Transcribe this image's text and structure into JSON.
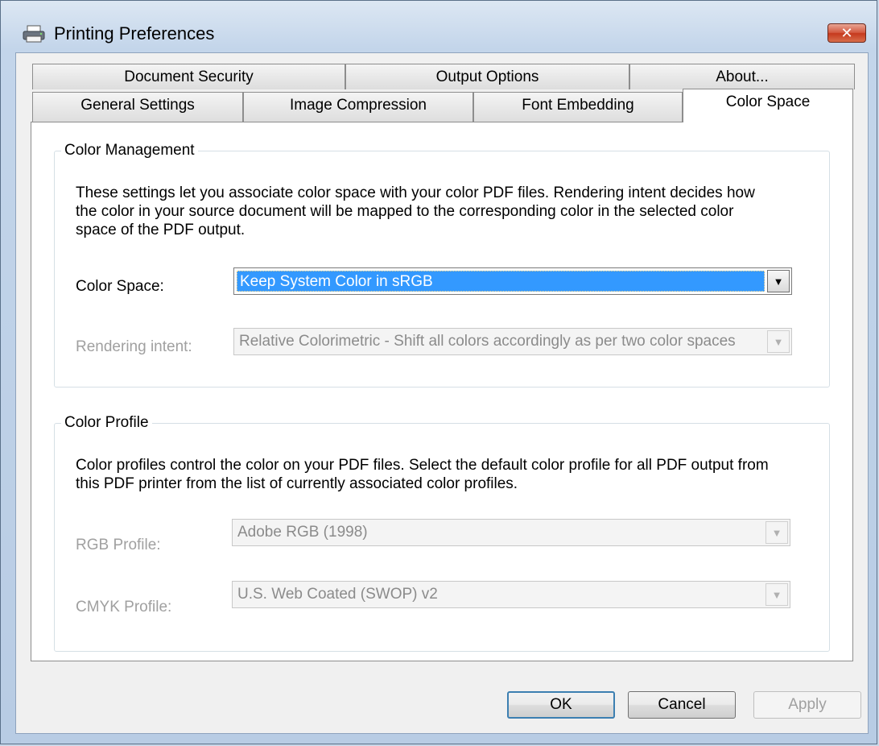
{
  "window": {
    "title": "Printing Preferences",
    "close_label": "✕"
  },
  "tabs": {
    "row1": [
      "Document Security",
      "Output Options",
      "About..."
    ],
    "row2": [
      "General Settings",
      "Image Compression",
      "Font Embedding",
      "Color Space"
    ],
    "active": "Color Space"
  },
  "color_management": {
    "legend": "Color Management",
    "description_lines": [
      "These settings let you associate color space with your color PDF files. Rendering intent decides how",
      "the color in your source document will be mapped to the corresponding color in the selected color",
      "space of the PDF output."
    ],
    "color_space_label": "Color Space:",
    "color_space_value": "Keep System Color in sRGB",
    "rendering_intent_label": "Rendering intent:",
    "rendering_intent_value": "Relative Colorimetric - Shift all colors accordingly as per two color spaces"
  },
  "color_profile": {
    "legend": "Color Profile",
    "description_lines": [
      "Color profiles control the color on your PDF files. Select the default color profile for all PDF output from",
      "this PDF printer from the list of currently associated color profiles."
    ],
    "rgb_label": "RGB Profile:",
    "rgb_value": "Adobe RGB (1998)",
    "cmyk_label": "CMYK Profile:",
    "cmyk_value": "U.S. Web Coated (SWOP) v2"
  },
  "buttons": {
    "ok": "OK",
    "cancel": "Cancel",
    "apply": "Apply"
  },
  "icons": {
    "dropdown": "▼",
    "title": "printer-icon"
  }
}
